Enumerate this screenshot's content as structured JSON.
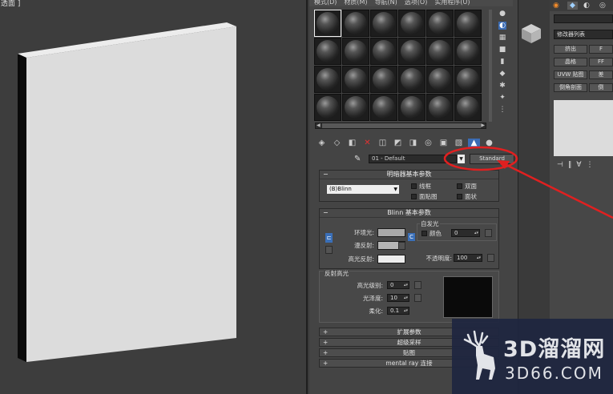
{
  "viewport": {
    "label": "透面 ]"
  },
  "material_editor": {
    "menu": [
      "模式(D)",
      "材质(M)",
      "导航(N)",
      "选项(O)",
      "实用程序(U)"
    ],
    "material_name": "01 - Default",
    "material_type_button": "Standard",
    "shader_rollout": {
      "title": "明暗器基本参数",
      "shader": "(B)Blinn",
      "checkboxes": [
        "线框",
        "双面",
        "面贴图",
        "面状"
      ]
    },
    "blinn_rollout": {
      "title": "Blinn 基本参数",
      "self_illum_group": "自发光",
      "color_label": "颜色",
      "color_value": "0",
      "ambient_label": "环境光:",
      "diffuse_label": "漫反射:",
      "specular_label": "高光反射:",
      "opacity_label": "不透明度:",
      "opacity_value": "100",
      "lock_label": "C"
    },
    "specular_group": {
      "title": "反射高光",
      "level_label": "高光级别:",
      "level_value": "0",
      "gloss_label": "光泽度:",
      "gloss_value": "10",
      "soften_label": "柔化:",
      "soften_value": "0.1"
    },
    "collapsed_rollouts": [
      "扩展参数",
      "超级采样",
      "贴图",
      "mental ray 连接"
    ]
  },
  "command_panel": {
    "modifier_list": "修改器列表",
    "buttons": [
      [
        "挤出",
        "F"
      ],
      [
        "晶格",
        "FF"
      ],
      [
        "UVW 贴图",
        "差"
      ],
      [
        "倒角剖面",
        "倒"
      ]
    ]
  },
  "watermark": {
    "brand": "3D溜溜网",
    "url": "3D66.COM"
  },
  "colors": {
    "annotation": "#e02020",
    "lock_active": "#3a6fb8"
  }
}
